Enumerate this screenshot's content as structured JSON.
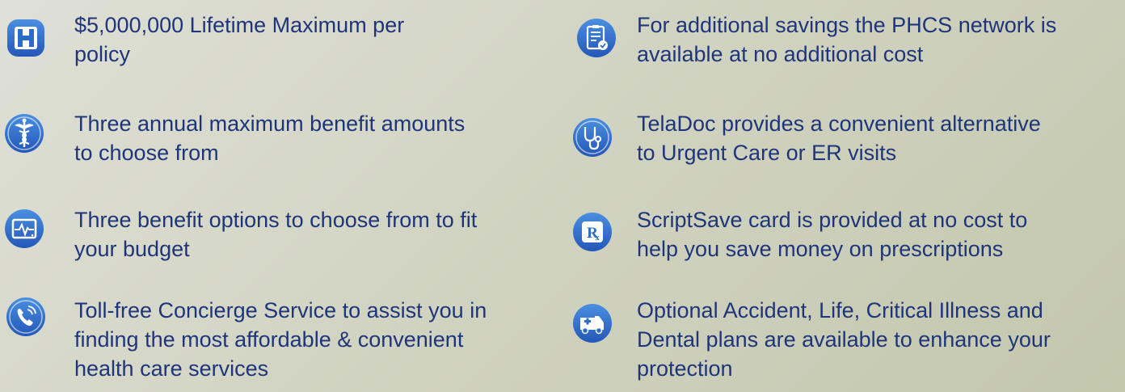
{
  "colors": {
    "icon_blue": "#2b6cc8",
    "text": "#1f3579",
    "background": "#d2d4c3"
  },
  "features": {
    "left": [
      {
        "icon": "hospital-h-icon",
        "text": "$5,000,000 Lifetime Maximum per policy",
        "lines": [
          "$5,000,000 Lifetime Maximum per",
          "policy"
        ]
      },
      {
        "icon": "caduceus-icon",
        "lines": [
          "Three annual maximum benefit amounts",
          "to choose from"
        ]
      },
      {
        "icon": "heart-monitor-icon",
        "lines": [
          "Three benefit options to choose from to fit",
          "your budget"
        ]
      },
      {
        "icon": "phone-icon",
        "lines": [
          "Toll-free Concierge Service to assist you in",
          "finding the most affordable & convenient",
          "health care services"
        ]
      }
    ],
    "right": [
      {
        "icon": "clipboard-check-icon",
        "lines": [
          "For additional savings the PHCS network is",
          "available at no additional cost"
        ]
      },
      {
        "icon": "stethoscope-icon",
        "lines": [
          "TelaDoc provides a convenient alternative",
          "to Urgent Care or ER visits"
        ]
      },
      {
        "icon": "rx-icon",
        "lines": [
          "ScriptSave card is provided at no cost to",
          "help you save money on prescriptions"
        ]
      },
      {
        "icon": "ambulance-icon",
        "lines": [
          "Optional Accident, Life, Critical Illness and",
          "Dental plans are available to enhance your",
          "protection"
        ]
      }
    ]
  }
}
